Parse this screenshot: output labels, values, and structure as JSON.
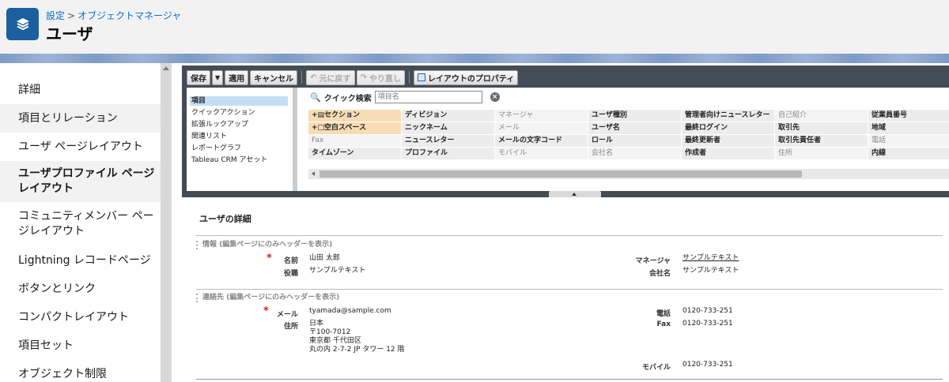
{
  "header": {
    "breadcrumb_root": "設定",
    "breadcrumb_sep": ">",
    "breadcrumb_current": "オブジェクトマネージャ",
    "title": "ユーザ",
    "icon": "layers-icon",
    "accent_color": "#1b5f9e"
  },
  "sidebar": {
    "items": [
      {
        "label": "詳細"
      },
      {
        "label": "項目とリレーション"
      },
      {
        "label": "ユーザ ページレイアウト"
      },
      {
        "label": "ユーザプロファイル ページ\nレイアウト"
      },
      {
        "label": "コミュニティメンバー ペー\nジレイアウト"
      },
      {
        "label": "Lightning レコードページ"
      },
      {
        "label": "ボタンとリンク"
      },
      {
        "label": "コンパクトレイアウト"
      },
      {
        "label": "項目セット"
      },
      {
        "label": "オブジェクト制限"
      }
    ],
    "active_index": 3
  },
  "toolbar": {
    "save": "保存",
    "apply": "適用",
    "cancel": "キャンセル",
    "undo": "元に戻す",
    "redo": "やり直し",
    "layout_props": "レイアウトのプロパティ"
  },
  "palette": {
    "categories": [
      "項目",
      "クイックアクション",
      "拡張ルックアップ",
      "関連リスト",
      "レポートグラフ",
      "Tableau CRM アセット"
    ],
    "selected_category": 0,
    "quick_find_label": "クイック検索",
    "quick_find_placeholder": "項目名",
    "fields": [
      [
        "セクション",
        "ディビジョン",
        "マネージャ",
        "ユーザ種別",
        "管理者向けニュースレター",
        "自己紹介",
        "従業員番号"
      ],
      [
        "空白スペース",
        "ニックネーム",
        "メール",
        "ユーザ名",
        "最終ログイン",
        "取引先",
        "地域"
      ],
      [
        "Fax",
        "ニュースレター",
        "メールの文字コード",
        "ロール",
        "最終更新者",
        "取引先責任者",
        "電話"
      ],
      [
        "タイムゾーン",
        "プロファイル",
        "モバイル",
        "会社名",
        "作成者",
        "住所",
        "内線"
      ]
    ]
  },
  "detail": {
    "title": "ユーザの詳細",
    "section1_head": "情報 (編集ページにのみヘッダーを表示)",
    "section2_head": "連絡先 (編集ページにのみヘッダーを表示)",
    "name_label": "名前",
    "name_value": "山田 太郎",
    "title_label": "役職",
    "title_value": "サンプルテキスト",
    "manager_label": "マネージャ",
    "manager_value": "サンプルテキスト",
    "company_label": "会社名",
    "company_value": "サンプルテキスト",
    "email_label": "メール",
    "email_value": "tyamada@sample.com",
    "address_label": "住所",
    "address_country": "日本",
    "address_zip": "〒100-7012",
    "address_city": "東京都 千代田区",
    "address_street": "丸の内 2-7-2 JP タワー 12 階",
    "phone_label": "電話",
    "phone_value": "0120-733-251",
    "fax_label": "Fax",
    "fax_value": "0120-733-251",
    "mobile_label": "モバイル",
    "mobile_value": "0120-733-251",
    "required_mark": "*"
  }
}
